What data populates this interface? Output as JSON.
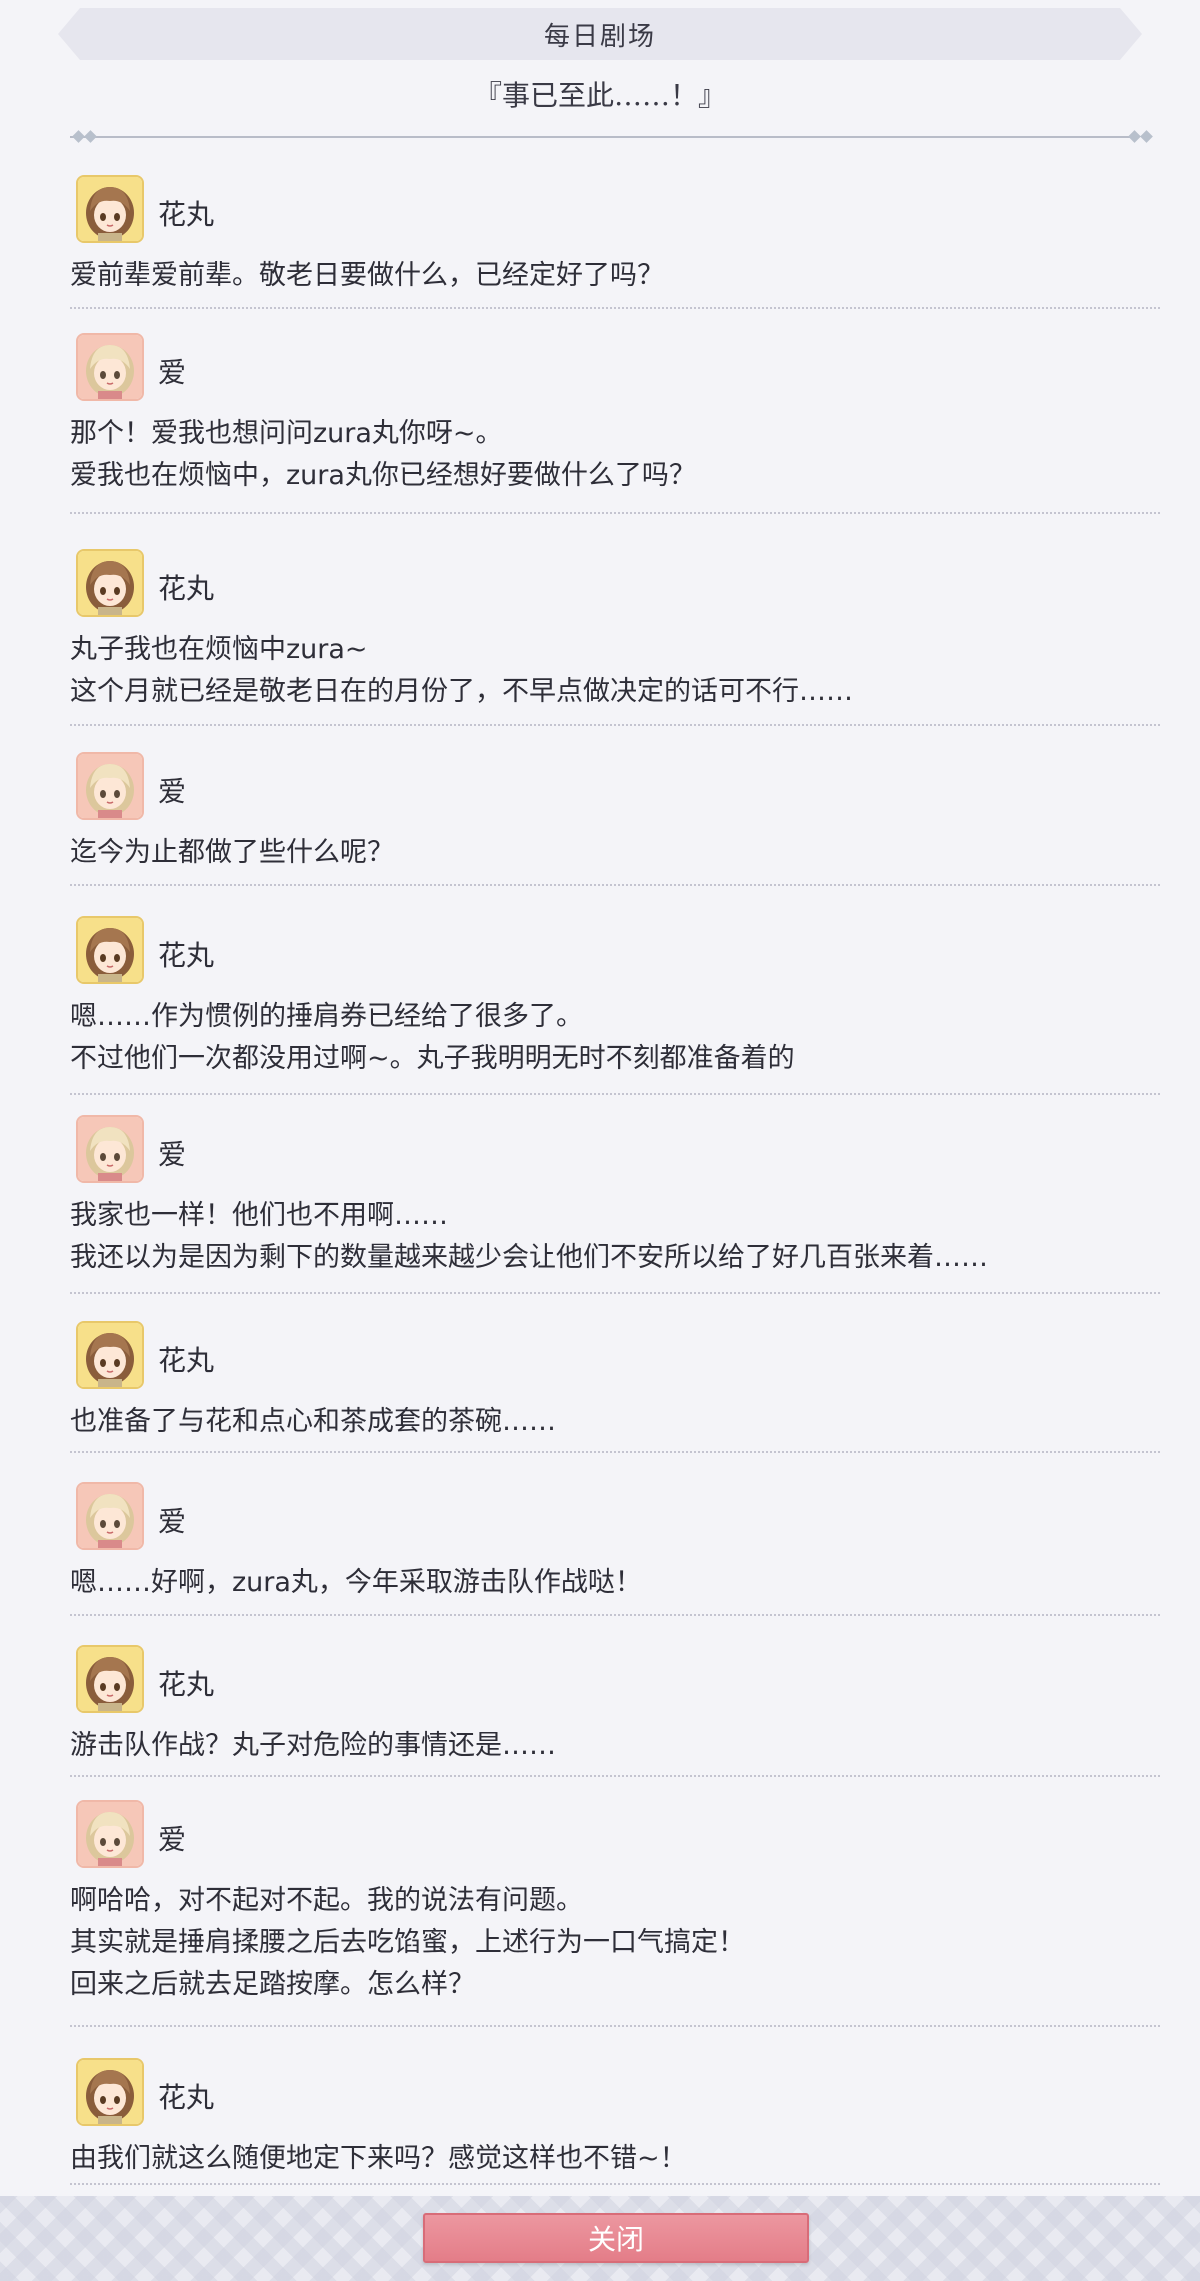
{
  "header": {
    "title": "每日剧场"
  },
  "episode": {
    "title": "『事已至此……！』"
  },
  "messages": [
    {
      "speaker": "花丸",
      "character": "hanamaru",
      "lines": [
        "爱前辈爱前辈。敬老日要做什么，已经定好了吗？"
      ]
    },
    {
      "speaker": "爱",
      "character": "ai",
      "lines": [
        "那个！爱我也想问问zura丸你呀~。",
        "爱我也在烦恼中，zura丸你已经想好要做什么了吗？"
      ]
    },
    {
      "speaker": "花丸",
      "character": "hanamaru",
      "lines": [
        "丸子我也在烦恼中zura~",
        "这个月就已经是敬老日在的月份了，不早点做决定的话可不行……"
      ]
    },
    {
      "speaker": "爱",
      "character": "ai",
      "lines": [
        "迄今为止都做了些什么呢？"
      ]
    },
    {
      "speaker": "花丸",
      "character": "hanamaru",
      "lines": [
        "嗯……作为惯例的捶肩券已经给了很多了。",
        "不过他们一次都没用过啊~。丸子我明明无时不刻都准备着的"
      ]
    },
    {
      "speaker": "爱",
      "character": "ai",
      "lines": [
        "我家也一样！他们也不用啊……",
        "我还以为是因为剩下的数量越来越少会让他们不安所以给了好几百张来着……"
      ]
    },
    {
      "speaker": "花丸",
      "character": "hanamaru",
      "lines": [
        "也准备了与花和点心和茶成套的茶碗……"
      ]
    },
    {
      "speaker": "爱",
      "character": "ai",
      "lines": [
        "嗯……好啊，zura丸，今年采取游击队作战哒！"
      ]
    },
    {
      "speaker": "花丸",
      "character": "hanamaru",
      "lines": [
        "游击队作战？丸子对危险的事情还是……"
      ]
    },
    {
      "speaker": "爱",
      "character": "ai",
      "lines": [
        "啊哈哈，对不起对不起。我的说法有问题。",
        "其实就是捶肩揉腰之后去吃馅蜜，上述行为一口气搞定！",
        "回来之后就去足踏按摩。怎么样？"
      ]
    },
    {
      "speaker": "花丸",
      "character": "hanamaru",
      "lines": [
        "由我们就这么随便地定下来吗？感觉这样也不错~！"
      ]
    }
  ],
  "footer": {
    "close_label": "关闭"
  },
  "colors": {
    "accent_button": "#e8858f",
    "background": "#f4f4f8",
    "hanamaru_avatar_bg": "#f7e08a",
    "ai_avatar_bg": "#f6c7b8"
  }
}
